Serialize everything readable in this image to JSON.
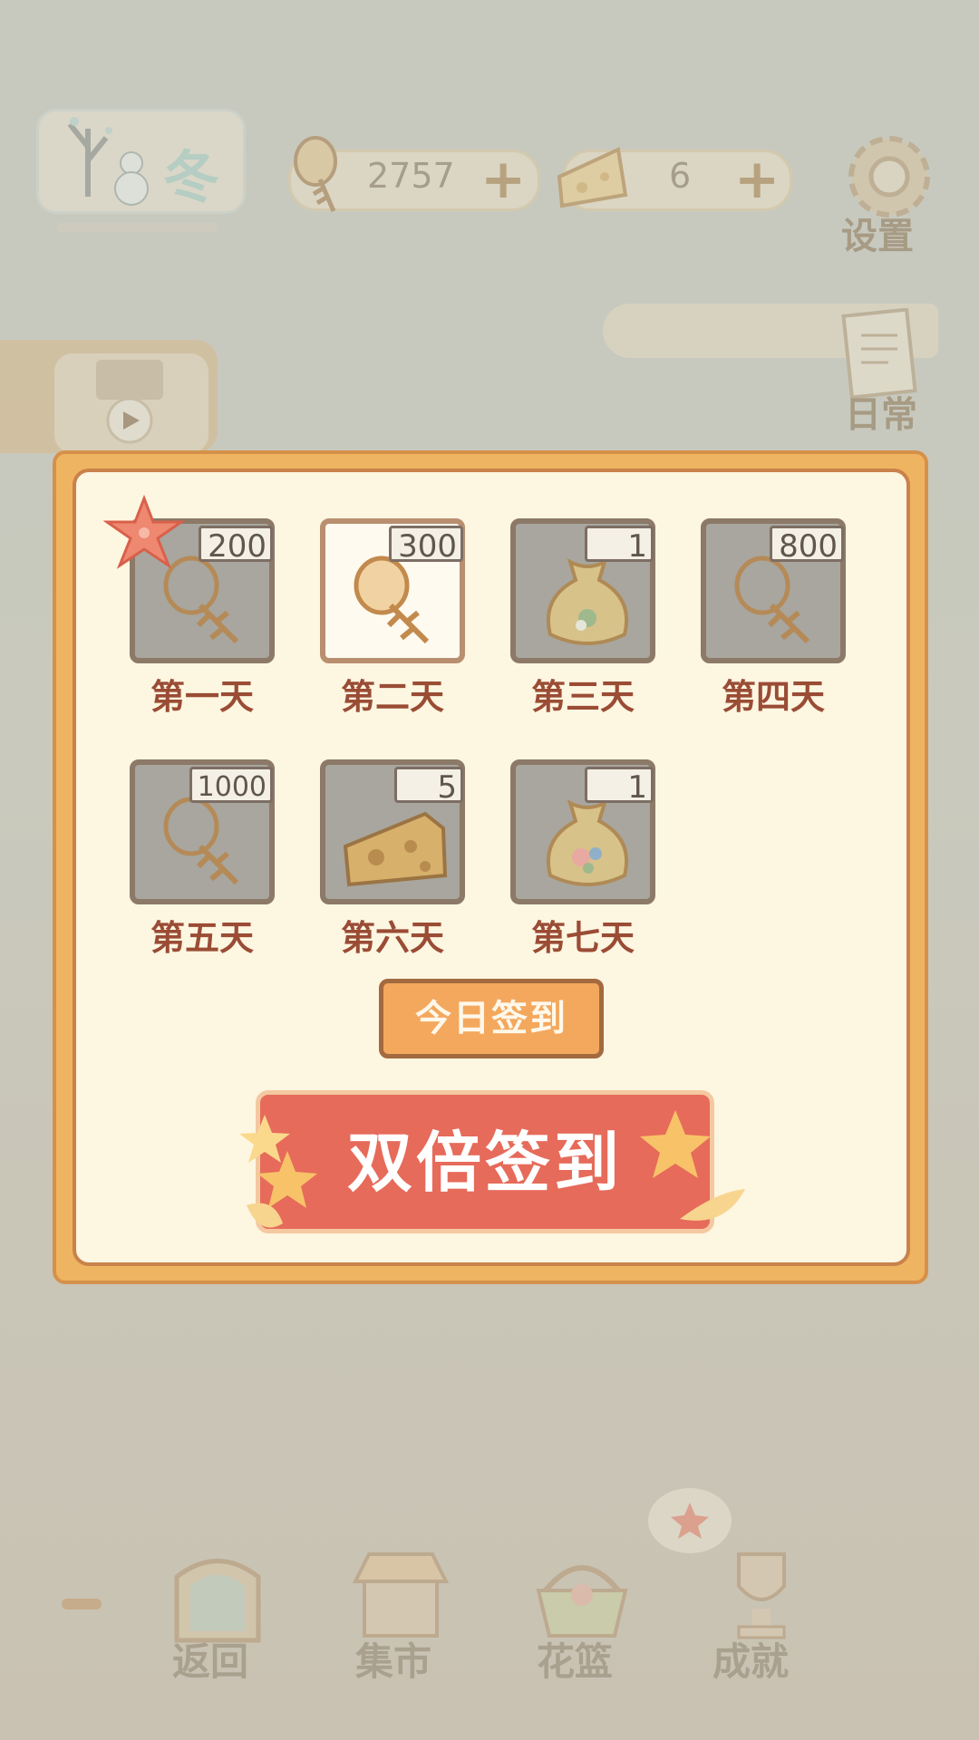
{
  "top_bar": {
    "season": "冬",
    "fish_count": "2757",
    "cheese_count": "6",
    "plus": "+",
    "settings_label": "设置"
  },
  "side": {
    "daily_label": "日常"
  },
  "checkin": {
    "days": [
      {
        "label": "第一天",
        "amount": "200",
        "reward": "fish-bone-icon",
        "claimed": false,
        "current": false
      },
      {
        "label": "第二天",
        "amount": "300",
        "reward": "fish-bone-icon",
        "claimed": false,
        "current": true
      },
      {
        "label": "第三天",
        "amount": "1",
        "reward": "seed-bag-icon",
        "claimed": false,
        "current": false
      },
      {
        "label": "第四天",
        "amount": "800",
        "reward": "fish-bone-icon",
        "claimed": false,
        "current": false
      },
      {
        "label": "第五天",
        "amount": "1000",
        "reward": "fish-bone-icon",
        "claimed": false,
        "current": false
      },
      {
        "label": "第六天",
        "amount": "5",
        "reward": "cheese-icon",
        "claimed": false,
        "current": false
      },
      {
        "label": "第七天",
        "amount": "1",
        "reward": "seed-bag-icon",
        "claimed": false,
        "current": false
      }
    ],
    "sign_today": "今日签到",
    "sign_double": "双倍签到"
  },
  "bottom_nav": [
    {
      "label": "返回",
      "icon": "window-icon"
    },
    {
      "label": "集市",
      "icon": "market-stall-icon"
    },
    {
      "label": "花篮",
      "icon": "flower-basket-icon"
    },
    {
      "label": "成就",
      "icon": "trophy-icon"
    }
  ],
  "colors": {
    "modal_frame": "#efb461",
    "modal_bg": "#fdf6e1",
    "day_text": "#9a4c35",
    "double_button": "#e66b5a",
    "today_button": "#f3a85e"
  }
}
